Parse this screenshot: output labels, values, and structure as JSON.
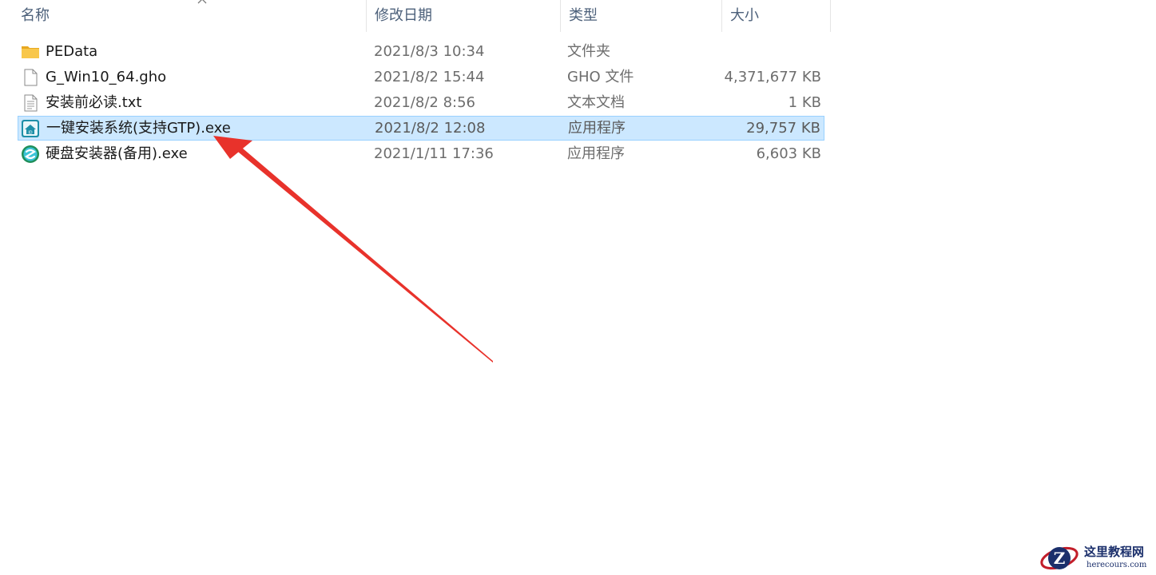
{
  "columns": {
    "name": "名称",
    "date": "修改日期",
    "type": "类型",
    "size": "大小"
  },
  "sort": {
    "column": "name",
    "direction": "ascending"
  },
  "files": [
    {
      "icon": "folder-icon",
      "name": "PEData",
      "date": "2021/8/3 10:34",
      "type": "文件夹",
      "size": ""
    },
    {
      "icon": "file-icon",
      "name": "G_Win10_64.gho",
      "date": "2021/8/2 15:44",
      "type": "GHO 文件",
      "size": "4,371,677 KB"
    },
    {
      "icon": "text-file-icon",
      "name": "安装前必读.txt",
      "date": "2021/8/2 8:56",
      "type": "文本文档",
      "size": "1 KB"
    },
    {
      "icon": "installer-app-icon",
      "name": "一键安装系统(支持GTP).exe",
      "date": "2021/8/2 12:08",
      "type": "应用程序",
      "size": "29,757 KB",
      "selected": true
    },
    {
      "icon": "disk-installer-app-icon",
      "name": "硬盘安装器(备用).exe",
      "date": "2021/1/11 17:36",
      "type": "应用程序",
      "size": "6,603 KB"
    }
  ],
  "annotation": {
    "color": "#e8322b",
    "points_to": "一键安装系统(支持GTP).exe"
  },
  "watermark": {
    "logo_letter": "Z",
    "title": "这里教程网",
    "url": "herecours.com"
  },
  "colors": {
    "selection_bg": "#cce8ff",
    "selection_border": "#99d1ff",
    "header_text": "#4c607a",
    "folder": "#f8c74b",
    "arrow": "#e8322b"
  }
}
